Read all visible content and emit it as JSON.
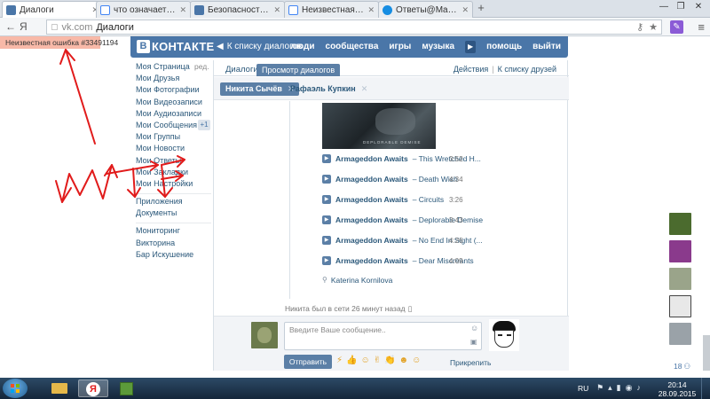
{
  "browser": {
    "tabs": [
      {
        "label": "Диалоги",
        "active": true,
        "icon": "vk-favicon",
        "color": "#4a76a8"
      },
      {
        "label": "что означает ошибка",
        "active": false,
        "icon": "google-favicon",
        "color": "#4285f4"
      },
      {
        "label": "Безопасность: ВКонт",
        "active": false,
        "icon": "vk-favicon",
        "color": "#4a76a8"
      },
      {
        "label": "Неизвестная ошибка",
        "active": false,
        "icon": "google-favicon",
        "color": "#4285f4"
      },
      {
        "label": "Ответы@Mail.Ru: Неи",
        "active": false,
        "icon": "mailru-favicon",
        "color": "#168de2"
      }
    ],
    "new_tab": "+",
    "window_controls": [
      "—",
      "❐",
      "✕"
    ],
    "back": "←",
    "browser_logo": "Я",
    "url_domain": "vk.com",
    "url_sep": "",
    "page_title": "Диалоги",
    "ext_label": "✎",
    "menu": "≡"
  },
  "error_badge": "Неизвестная ошибка #33491194",
  "vk": {
    "logo_letter": "В",
    "logo_text": "КОНТАКТЕ",
    "back_arrow": "◀",
    "back_label": "К списку диалогов",
    "nav": [
      "люди",
      "сообщества",
      "игры",
      "музыка",
      "помощь",
      "выйти"
    ],
    "play": "▶"
  },
  "left_menu": {
    "edit": "ред.",
    "messages_count": "+1",
    "group1": [
      "Моя Страница",
      "Мои Друзья",
      "Мои Фотографии",
      "Мои Видеозаписи",
      "Мои Аудиозаписи",
      "Мои Сообщения",
      "Мои Группы",
      "Мои Новости",
      "Мои Ответы",
      "Мои Закладки",
      "Мои Настройки"
    ],
    "group2": [
      "Приложения",
      "Документы"
    ],
    "group3": [
      "Мониторинг",
      "Викторина",
      "Бар Искушение"
    ]
  },
  "main": {
    "tab_dialogs": "Диалоги",
    "tab_view": "Просмотр диалогов",
    "actions": "Действия",
    "separator": "|",
    "to_friends": "К списку друзей",
    "conversations": [
      {
        "name": "Никита Сычёв",
        "close": "✕",
        "active": true
      },
      {
        "name": "Рафаэль Купкин",
        "close": "✕",
        "active": false
      }
    ],
    "album_text": "DEPLORABLE DEMISE",
    "tracks": [
      {
        "artist": "Armageddon Awaits",
        "title": "– This Wretched H...",
        "duration": "3:52"
      },
      {
        "artist": "Armageddon Awaits",
        "title": "– Death Wish",
        "duration": "4:34"
      },
      {
        "artist": "Armageddon Awaits",
        "title": "– Circuits",
        "duration": "3:26"
      },
      {
        "artist": "Armageddon Awaits",
        "title": "– Deplorable Demise",
        "duration": "3:43"
      },
      {
        "artist": "Armageddon Awaits",
        "title": "– No End In Sight (...",
        "duration": "4:26"
      },
      {
        "artist": "Armageddon Awaits",
        "title": "– Dear Miscreants",
        "duration": "4:09"
      }
    ],
    "track_play": "▶",
    "sender_icon": "⚲",
    "sender": "Katerina Kornilova",
    "online_status": "Никита был в сети 26 минут назад",
    "mobile_icon": "▯"
  },
  "compose": {
    "placeholder": "Введите Ваше сообщение..",
    "smile": "☺",
    "camera": "▣",
    "send": "Отправить",
    "emojis": [
      "⚡",
      "👍",
      "☺",
      "✌",
      "👏",
      "☻",
      "☺"
    ],
    "attach": "Прикрепить"
  },
  "right_strip": {
    "avatars": [
      "#4b6b2e",
      "#8a3a8c",
      "#9aa48a",
      "#e8e8e8",
      "#9aa2a8"
    ],
    "count": "18",
    "count_icon": "⚇"
  },
  "taskbar": {
    "lang": "RU",
    "tray": [
      "⚑",
      "▴",
      "▮",
      "◉",
      "♪"
    ],
    "time": "20:14",
    "date": "28.09.2015",
    "apps": [
      {
        "name": "explorer",
        "color": "#e5b84a"
      },
      {
        "name": "yandex-browser",
        "color": "#ffffff"
      },
      {
        "name": "minecraft",
        "color": "#5c9a3a"
      }
    ]
  },
  "colors": {
    "vk_blue": "#4a76a8",
    "tab_blue": "#5b7fa6",
    "link": "#2b587a",
    "doodle_red": "#e11b1b",
    "error_bg": "#f8b9a8"
  }
}
